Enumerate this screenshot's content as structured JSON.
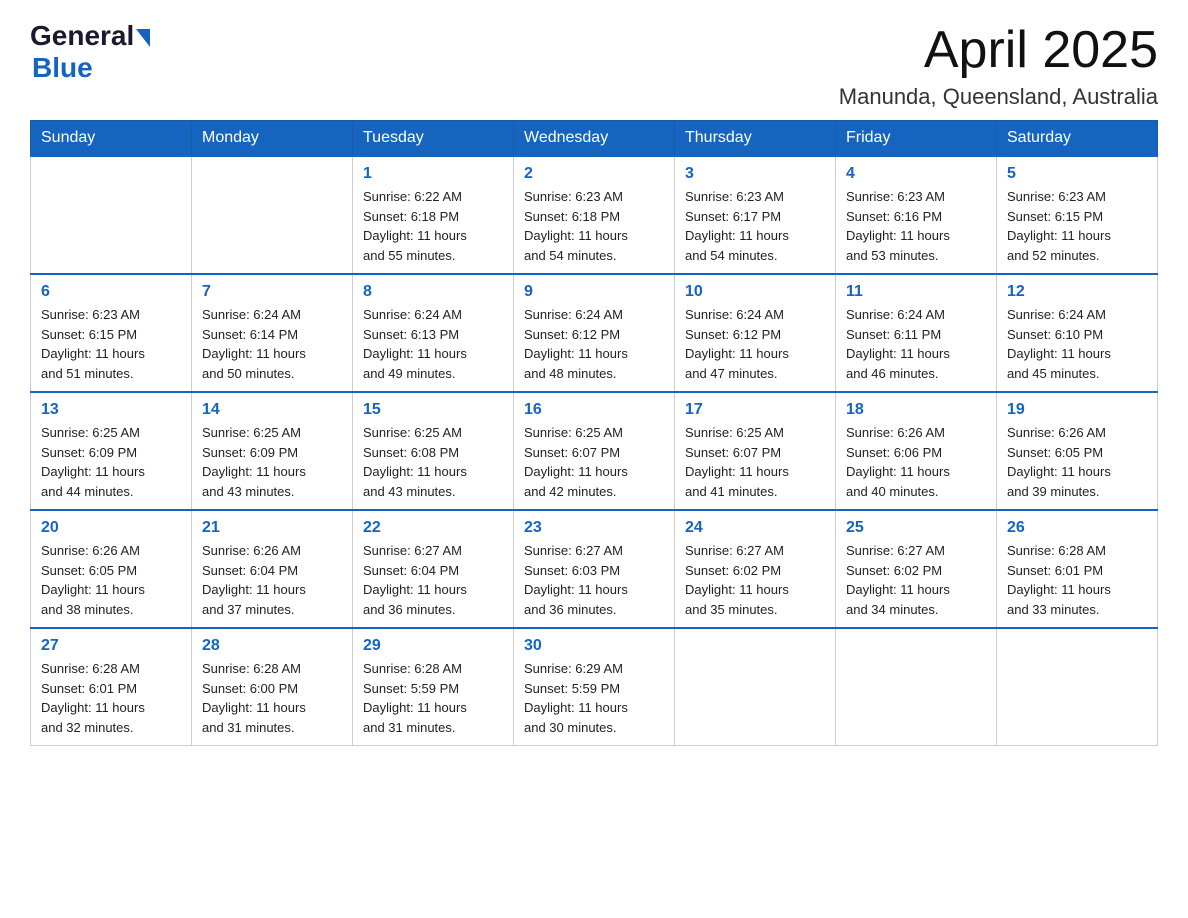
{
  "header": {
    "logo_general": "General",
    "logo_blue": "Blue",
    "month_title": "April 2025",
    "location": "Manunda, Queensland, Australia"
  },
  "weekdays": [
    "Sunday",
    "Monday",
    "Tuesday",
    "Wednesday",
    "Thursday",
    "Friday",
    "Saturday"
  ],
  "weeks": [
    [
      {
        "day": "",
        "info": ""
      },
      {
        "day": "",
        "info": ""
      },
      {
        "day": "1",
        "info": "Sunrise: 6:22 AM\nSunset: 6:18 PM\nDaylight: 11 hours\nand 55 minutes."
      },
      {
        "day": "2",
        "info": "Sunrise: 6:23 AM\nSunset: 6:18 PM\nDaylight: 11 hours\nand 54 minutes."
      },
      {
        "day": "3",
        "info": "Sunrise: 6:23 AM\nSunset: 6:17 PM\nDaylight: 11 hours\nand 54 minutes."
      },
      {
        "day": "4",
        "info": "Sunrise: 6:23 AM\nSunset: 6:16 PM\nDaylight: 11 hours\nand 53 minutes."
      },
      {
        "day": "5",
        "info": "Sunrise: 6:23 AM\nSunset: 6:15 PM\nDaylight: 11 hours\nand 52 minutes."
      }
    ],
    [
      {
        "day": "6",
        "info": "Sunrise: 6:23 AM\nSunset: 6:15 PM\nDaylight: 11 hours\nand 51 minutes."
      },
      {
        "day": "7",
        "info": "Sunrise: 6:24 AM\nSunset: 6:14 PM\nDaylight: 11 hours\nand 50 minutes."
      },
      {
        "day": "8",
        "info": "Sunrise: 6:24 AM\nSunset: 6:13 PM\nDaylight: 11 hours\nand 49 minutes."
      },
      {
        "day": "9",
        "info": "Sunrise: 6:24 AM\nSunset: 6:12 PM\nDaylight: 11 hours\nand 48 minutes."
      },
      {
        "day": "10",
        "info": "Sunrise: 6:24 AM\nSunset: 6:12 PM\nDaylight: 11 hours\nand 47 minutes."
      },
      {
        "day": "11",
        "info": "Sunrise: 6:24 AM\nSunset: 6:11 PM\nDaylight: 11 hours\nand 46 minutes."
      },
      {
        "day": "12",
        "info": "Sunrise: 6:24 AM\nSunset: 6:10 PM\nDaylight: 11 hours\nand 45 minutes."
      }
    ],
    [
      {
        "day": "13",
        "info": "Sunrise: 6:25 AM\nSunset: 6:09 PM\nDaylight: 11 hours\nand 44 minutes."
      },
      {
        "day": "14",
        "info": "Sunrise: 6:25 AM\nSunset: 6:09 PM\nDaylight: 11 hours\nand 43 minutes."
      },
      {
        "day": "15",
        "info": "Sunrise: 6:25 AM\nSunset: 6:08 PM\nDaylight: 11 hours\nand 43 minutes."
      },
      {
        "day": "16",
        "info": "Sunrise: 6:25 AM\nSunset: 6:07 PM\nDaylight: 11 hours\nand 42 minutes."
      },
      {
        "day": "17",
        "info": "Sunrise: 6:25 AM\nSunset: 6:07 PM\nDaylight: 11 hours\nand 41 minutes."
      },
      {
        "day": "18",
        "info": "Sunrise: 6:26 AM\nSunset: 6:06 PM\nDaylight: 11 hours\nand 40 minutes."
      },
      {
        "day": "19",
        "info": "Sunrise: 6:26 AM\nSunset: 6:05 PM\nDaylight: 11 hours\nand 39 minutes."
      }
    ],
    [
      {
        "day": "20",
        "info": "Sunrise: 6:26 AM\nSunset: 6:05 PM\nDaylight: 11 hours\nand 38 minutes."
      },
      {
        "day": "21",
        "info": "Sunrise: 6:26 AM\nSunset: 6:04 PM\nDaylight: 11 hours\nand 37 minutes."
      },
      {
        "day": "22",
        "info": "Sunrise: 6:27 AM\nSunset: 6:04 PM\nDaylight: 11 hours\nand 36 minutes."
      },
      {
        "day": "23",
        "info": "Sunrise: 6:27 AM\nSunset: 6:03 PM\nDaylight: 11 hours\nand 36 minutes."
      },
      {
        "day": "24",
        "info": "Sunrise: 6:27 AM\nSunset: 6:02 PM\nDaylight: 11 hours\nand 35 minutes."
      },
      {
        "day": "25",
        "info": "Sunrise: 6:27 AM\nSunset: 6:02 PM\nDaylight: 11 hours\nand 34 minutes."
      },
      {
        "day": "26",
        "info": "Sunrise: 6:28 AM\nSunset: 6:01 PM\nDaylight: 11 hours\nand 33 minutes."
      }
    ],
    [
      {
        "day": "27",
        "info": "Sunrise: 6:28 AM\nSunset: 6:01 PM\nDaylight: 11 hours\nand 32 minutes."
      },
      {
        "day": "28",
        "info": "Sunrise: 6:28 AM\nSunset: 6:00 PM\nDaylight: 11 hours\nand 31 minutes."
      },
      {
        "day": "29",
        "info": "Sunrise: 6:28 AM\nSunset: 5:59 PM\nDaylight: 11 hours\nand 31 minutes."
      },
      {
        "day": "30",
        "info": "Sunrise: 6:29 AM\nSunset: 5:59 PM\nDaylight: 11 hours\nand 30 minutes."
      },
      {
        "day": "",
        "info": ""
      },
      {
        "day": "",
        "info": ""
      },
      {
        "day": "",
        "info": ""
      }
    ]
  ]
}
